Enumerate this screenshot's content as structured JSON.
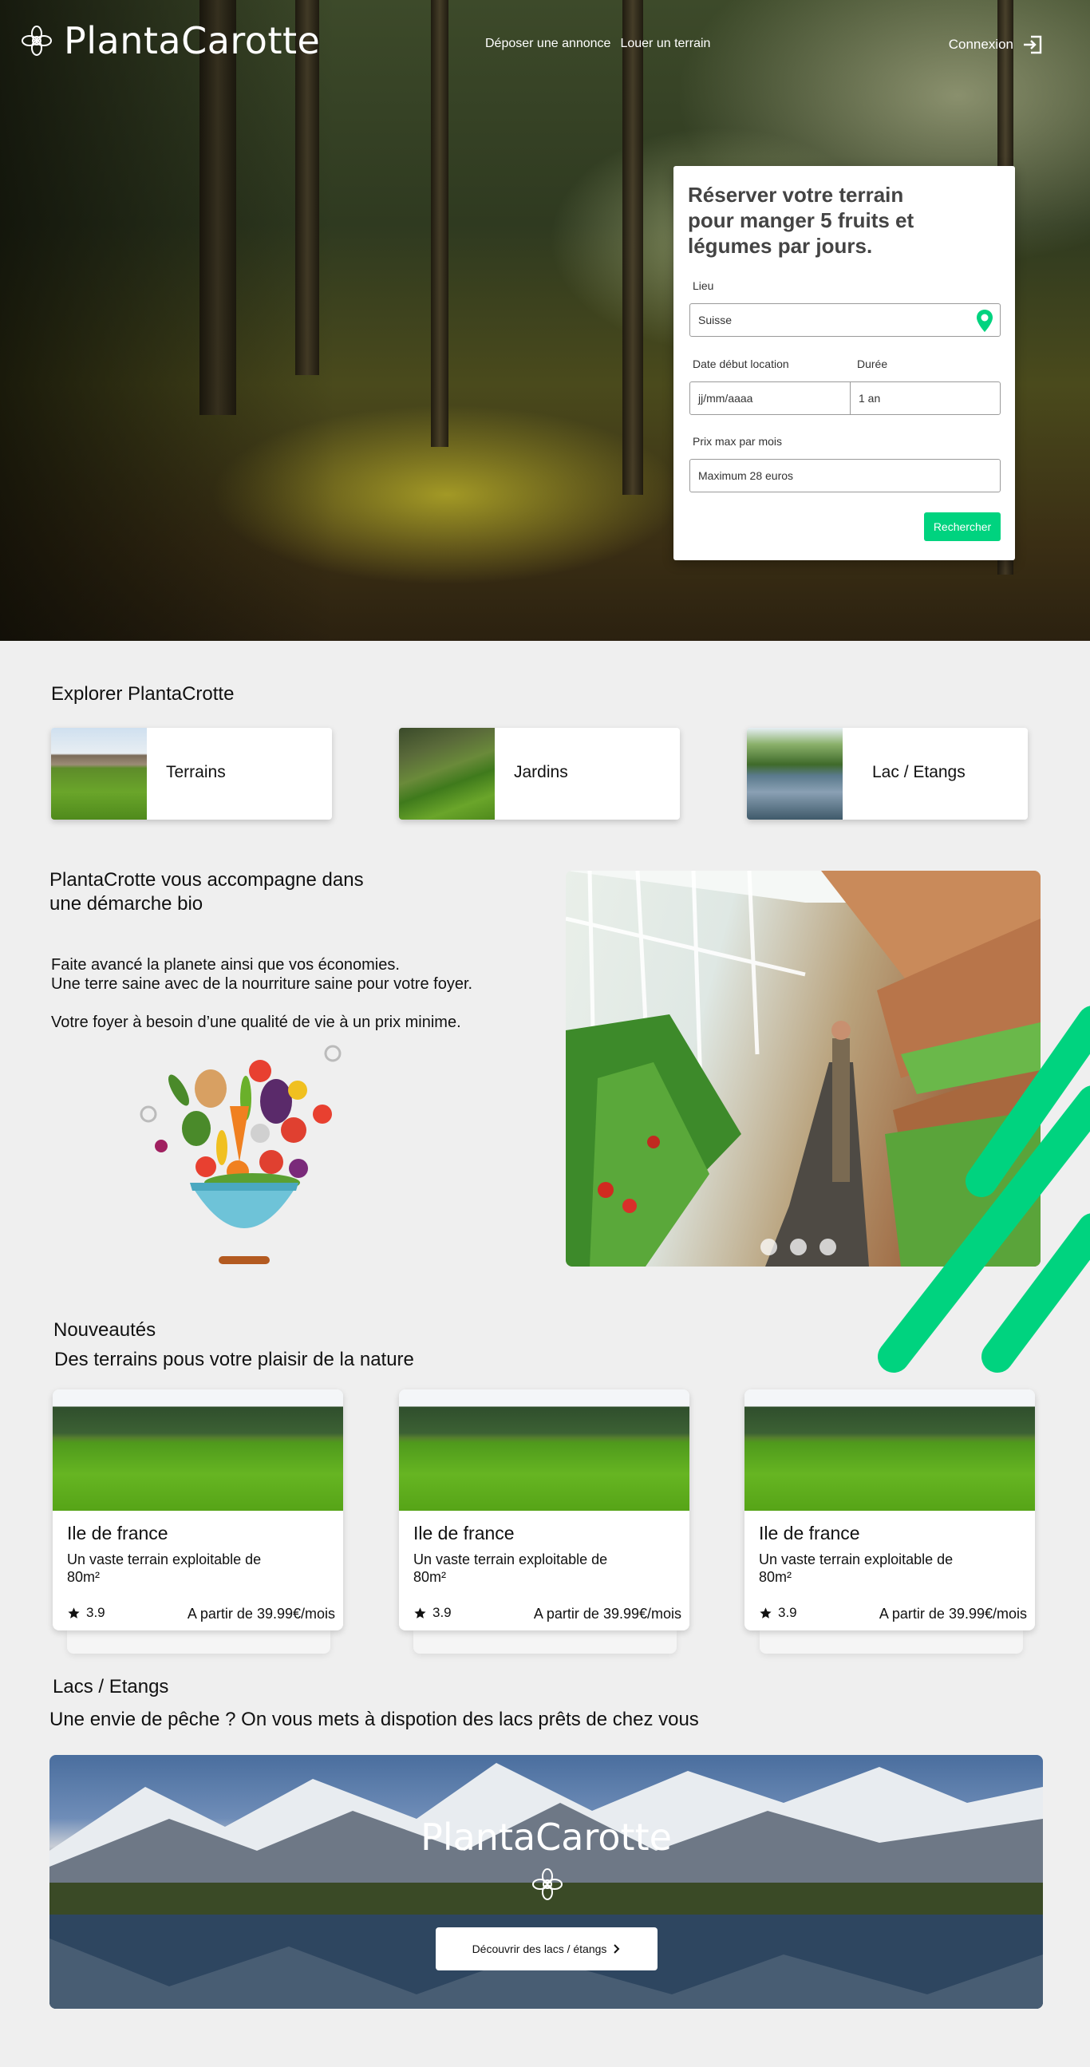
{
  "header": {
    "brand": "PlantaCarotte",
    "nav": [
      "Déposer une annonce",
      "Louer un terrain"
    ],
    "login_label": "Connexion"
  },
  "booking": {
    "title": "Réserver votre terrain pour manger 5 fruits et légumes par jours.",
    "location_label": "Lieu",
    "location_value": "Suisse",
    "start_label": "Date début location",
    "start_placeholder": "jj/mm/aaaa",
    "duration_label": "Durée",
    "duration_value": "1 an",
    "price_label": "Prix max par mois",
    "price_value": "Maximum 28 euros",
    "search_button": "Rechercher",
    "accent": "#00d37f"
  },
  "explore": {
    "title": "Explorer PlantaCrotte",
    "cards": [
      {
        "label": "Terrains"
      },
      {
        "label": "Jardins"
      },
      {
        "label": "Lac / Etangs"
      }
    ]
  },
  "bio": {
    "title": "PlantaCrotte vous accompagne dans une démarche bio",
    "line1": "Faite avancé la planete ainsi que vos économies.",
    "line2": "Une terre saine avec de la nourriture saine pour votre foyer.",
    "line3": "Votre foyer à besoin d’une qualité de vie à un prix minime."
  },
  "news": {
    "title": "Nouveautés",
    "subtitle": "Des terrains pous votre plaisir de la nature",
    "cards": [
      {
        "title": "Ile de france",
        "desc": "Un vaste terrain exploitable de 80m²",
        "rating": "3.9",
        "price": "A partir de 39.99€/mois"
      },
      {
        "title": "Ile de france",
        "desc": "Un vaste terrain exploitable de 80m²",
        "rating": "3.9",
        "price": "A partir de 39.99€/mois"
      },
      {
        "title": "Ile de france",
        "desc": "Un vaste terrain exploitable de 80m²",
        "rating": "3.9",
        "price": "A partir de 39.99€/mois"
      }
    ]
  },
  "lakes": {
    "title": "Lacs / Etangs",
    "subtitle": "Une envie de pêche ? On vous mets à dispotion des lacs prêts de chez vous",
    "brand": "PlantaCarotte",
    "button": "Découvrir des lacs / étangs"
  }
}
